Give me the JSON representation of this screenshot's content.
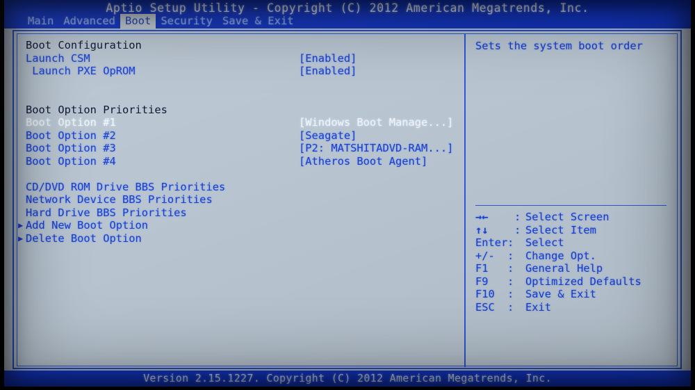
{
  "header": {
    "title": "Aptio Setup Utility - Copyright (C) 2012 American Megatrends, Inc."
  },
  "tabs": [
    {
      "label": "Main",
      "selected": false
    },
    {
      "label": "Advanced",
      "selected": false
    },
    {
      "label": "Boot",
      "selected": true
    },
    {
      "label": "Security",
      "selected": false
    },
    {
      "label": "Save & Exit",
      "selected": false
    }
  ],
  "main": {
    "section_boot_configuration": "Boot Configuration",
    "launch_csm_label": "Launch CSM",
    "launch_csm_value": "[Enabled]",
    "launch_pxe_label": " Launch PXE OpROM",
    "launch_pxe_value": "[Enabled]",
    "section_boot_option_priorities": "Boot Option Priorities",
    "boot_option_1_label": "Boot Option #1",
    "boot_option_1_value": "[Windows Boot Manage...]",
    "boot_option_2_label": "Boot Option #2",
    "boot_option_2_value": "[Seagate]",
    "boot_option_3_label": "Boot Option #3",
    "boot_option_3_value": "[P2: MATSHITADVD-RAM...]",
    "boot_option_4_label": "Boot Option #4",
    "boot_option_4_value": "[Atheros Boot Agent]",
    "cddvd_bbs_label": "CD/DVD ROM Drive BBS Priorities",
    "network_bbs_label": "Network Device BBS Priorities",
    "harddrive_bbs_label": "Hard Drive BBS Priorities",
    "add_new_boot_option_label": "Add New Boot Option",
    "delete_boot_option_label": "Delete Boot Option",
    "submenu_arrow": "▶"
  },
  "help": {
    "description": "Sets the system boot order"
  },
  "legend": [
    {
      "key": "→←",
      "sep": ":",
      "action": "Select Screen",
      "compact": false
    },
    {
      "key": "↑↓",
      "sep": ":",
      "action": "Select Item",
      "compact": false
    },
    {
      "key": "Enter",
      "sep": ":",
      "action": "Select",
      "compact": true
    },
    {
      "key": "+/-",
      "sep": ":",
      "action": "Change Opt.",
      "compact": false
    },
    {
      "key": "F1",
      "sep": ":",
      "action": "General Help",
      "compact": false
    },
    {
      "key": "F9",
      "sep": ":",
      "action": "Optimized Defaults",
      "compact": false
    },
    {
      "key": "F10",
      "sep": ":",
      "action": "Save & Exit",
      "compact": false
    },
    {
      "key": "ESC",
      "sep": ":",
      "action": "Exit",
      "compact": false
    }
  ],
  "footer": {
    "version": "Version 2.15.1227. Copyright (C) 2012 American Megatrends, Inc."
  },
  "colors": {
    "bar_blue": "#1036c8",
    "screen_bg": "#b9c6d2",
    "item_blue": "#1b3fd0",
    "heading_dark": "#0d1430",
    "selected_white": "#f2f6fb",
    "frame_blue": "#2550cf",
    "tab_selected_bg": "#c3ced7"
  }
}
